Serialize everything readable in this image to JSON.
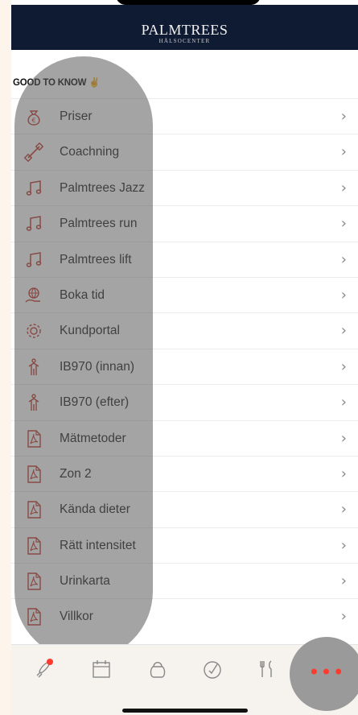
{
  "header": {
    "brand_name": "PALMTREES",
    "brand_sub": "HÄLSOCENTER"
  },
  "section": {
    "heading": "GOOD TO KNOW",
    "heading_emoji": "✌"
  },
  "items": [
    {
      "label": "Priser",
      "icon": "money-bag-icon"
    },
    {
      "label": "Coachning",
      "icon": "dumbbell-icon"
    },
    {
      "label": "Palmtrees Jazz",
      "icon": "music-note-icon"
    },
    {
      "label": "Palmtrees run",
      "icon": "music-note-icon"
    },
    {
      "label": "Palmtrees lift",
      "icon": "music-note-icon"
    },
    {
      "label": "Boka tid",
      "icon": "globe-hand-icon"
    },
    {
      "label": "Kundportal",
      "icon": "gears-icon"
    },
    {
      "label": "IB970 (innan)",
      "icon": "person-arrow-icon"
    },
    {
      "label": "IB970 (efter)",
      "icon": "person-arrow-icon"
    },
    {
      "label": "Mätmetoder",
      "icon": "pdf-icon"
    },
    {
      "label": "Zon 2",
      "icon": "pdf-icon"
    },
    {
      "label": "Kända dieter",
      "icon": "pdf-icon"
    },
    {
      "label": "Rätt intensitet",
      "icon": "pdf-icon"
    },
    {
      "label": "Urinkarta",
      "icon": "pdf-icon"
    },
    {
      "label": "Villkor",
      "icon": "pdf-icon"
    }
  ],
  "chevron": "›",
  "tabbar": {
    "tabs": [
      "rocket-icon",
      "calendar-icon",
      "kettlebell-icon",
      "achievement-icon",
      "fork-knife-icon",
      "more-icon"
    ],
    "more_label": "•••"
  },
  "colors": {
    "accent": "#c0392b",
    "header_bg": "#0f1a33",
    "more_dots": "#ff3b30"
  }
}
